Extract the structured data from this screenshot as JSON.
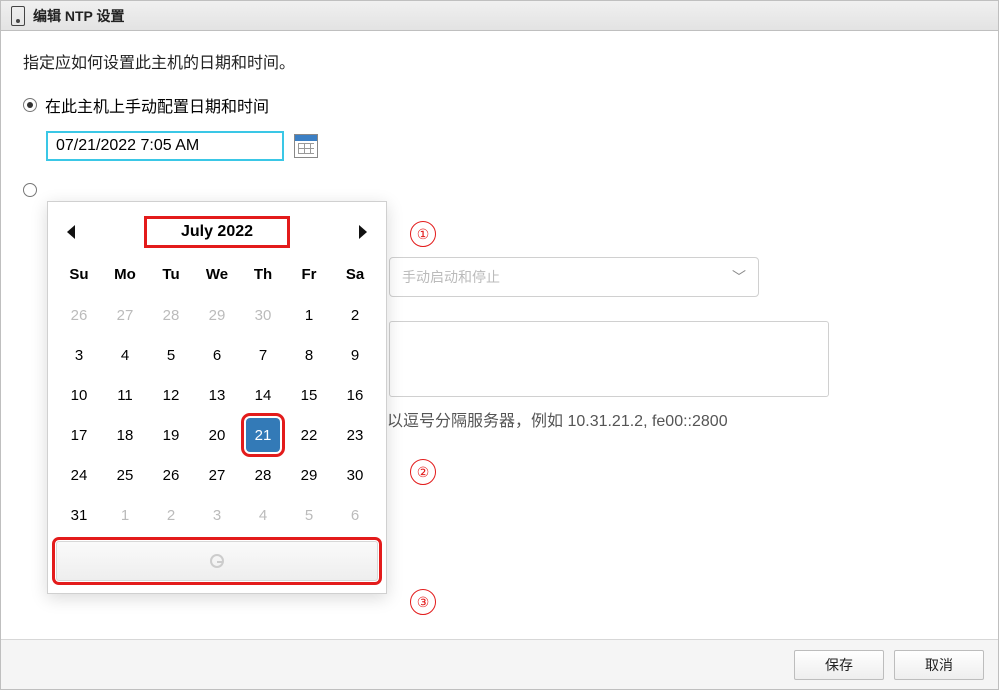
{
  "dialog": {
    "title": "编辑 NTP 设置",
    "description": "指定应如何设置此主机的日期和时间。",
    "radio1_label": "在此主机上手动配置日期和时间",
    "datetime_value": "07/21/2022 7:05 AM",
    "service_select_placeholder": "手动启动和停止",
    "server_hint": "以逗号分隔服务器，例如 10.31.21.2, fe00::2800"
  },
  "calendar": {
    "month_label": "July 2022",
    "dow": [
      "Su",
      "Mo",
      "Tu",
      "We",
      "Th",
      "Fr",
      "Sa"
    ],
    "weeks": [
      [
        {
          "d": "26",
          "o": true
        },
        {
          "d": "27",
          "o": true
        },
        {
          "d": "28",
          "o": true
        },
        {
          "d": "29",
          "o": true
        },
        {
          "d": "30",
          "o": true
        },
        {
          "d": "1"
        },
        {
          "d": "2"
        }
      ],
      [
        {
          "d": "3"
        },
        {
          "d": "4"
        },
        {
          "d": "5"
        },
        {
          "d": "6"
        },
        {
          "d": "7"
        },
        {
          "d": "8"
        },
        {
          "d": "9"
        }
      ],
      [
        {
          "d": "10"
        },
        {
          "d": "11"
        },
        {
          "d": "12"
        },
        {
          "d": "13"
        },
        {
          "d": "14"
        },
        {
          "d": "15"
        },
        {
          "d": "16"
        }
      ],
      [
        {
          "d": "17"
        },
        {
          "d": "18"
        },
        {
          "d": "19"
        },
        {
          "d": "20"
        },
        {
          "d": "21",
          "sel": true
        },
        {
          "d": "22"
        },
        {
          "d": "23"
        }
      ],
      [
        {
          "d": "24"
        },
        {
          "d": "25"
        },
        {
          "d": "26"
        },
        {
          "d": "27"
        },
        {
          "d": "28"
        },
        {
          "d": "29"
        },
        {
          "d": "30"
        }
      ],
      [
        {
          "d": "31"
        },
        {
          "d": "1",
          "o": true
        },
        {
          "d": "2",
          "o": true
        },
        {
          "d": "3",
          "o": true
        },
        {
          "d": "4",
          "o": true
        },
        {
          "d": "5",
          "o": true
        },
        {
          "d": "6",
          "o": true
        }
      ]
    ]
  },
  "annotations": {
    "a1": "①",
    "a2": "②",
    "a3": "③"
  },
  "footer": {
    "save": "保存",
    "cancel": "取消"
  }
}
